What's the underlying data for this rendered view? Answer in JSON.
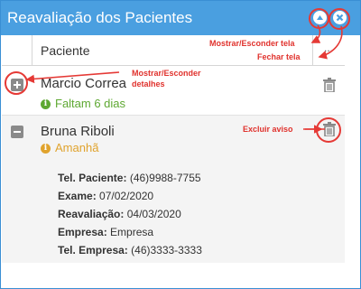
{
  "window": {
    "title": "Reavaliação dos Pacientes",
    "colors": {
      "titlebar": "#4a9fe0",
      "annotation": "#e0322d"
    }
  },
  "header_buttons": [
    {
      "icon": "chevron-up-icon"
    },
    {
      "icon": "close-icon"
    }
  ],
  "table": {
    "columns": [
      "Paciente",
      "..."
    ]
  },
  "patients": [
    {
      "name": "Marcio Correa",
      "status": "Faltam 6 dias",
      "status_color": "#5ea832",
      "expanded": false
    },
    {
      "name": "Bruna Riboli",
      "status": "Amanhã",
      "status_color": "#e0a32d",
      "expanded": true,
      "details": [
        {
          "label": "Tel. Paciente:",
          "value": " (46)9988-7755"
        },
        {
          "label": "Exame:",
          "value": " 07/02/2020"
        },
        {
          "label": "Reavaliação:",
          "value": " 04/03/2020"
        },
        {
          "label": "Empresa:",
          "value": " Empresa"
        },
        {
          "label": "Tel. Empresa:",
          "value": " (46)3333-3333"
        }
      ]
    }
  ],
  "annotations": {
    "toggle_window": "Mostrar/Esconder tela",
    "close_window": "Fechar tela",
    "toggle_details": "Mostrar/Esconder\ndetalhes",
    "delete_notice": "Excluir aviso"
  }
}
